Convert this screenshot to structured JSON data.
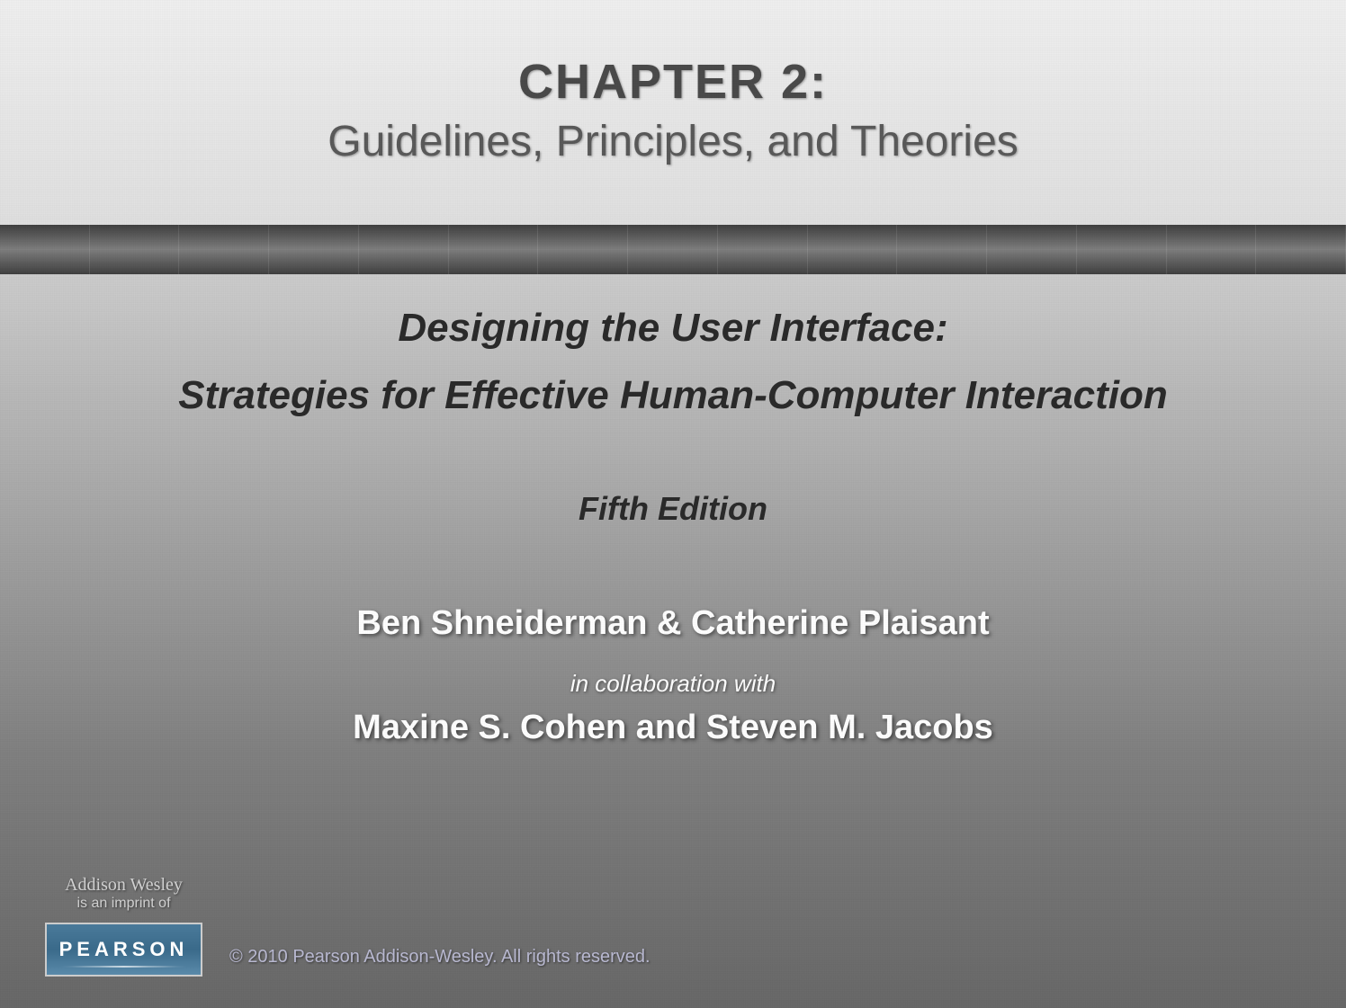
{
  "chapter": {
    "label": "CHAPTER 2:",
    "subtitle": "Guidelines, Principles, and Theories"
  },
  "book": {
    "title_line1": "Designing the User Interface:",
    "title_line2": "Strategies for Effective Human-Computer Interaction",
    "edition": "Fifth Edition"
  },
  "authors": {
    "primary": "Ben Shneiderman & Catherine Plaisant",
    "collaboration_label": "in collaboration with",
    "secondary": "Maxine S. Cohen and Steven M. Jacobs"
  },
  "publisher": {
    "imprint_name": "Addison Wesley",
    "imprint_of": "is an imprint of",
    "logo_text": "PEARSON",
    "copyright": "© 2010 Pearson Addison-Wesley. All rights reserved."
  }
}
